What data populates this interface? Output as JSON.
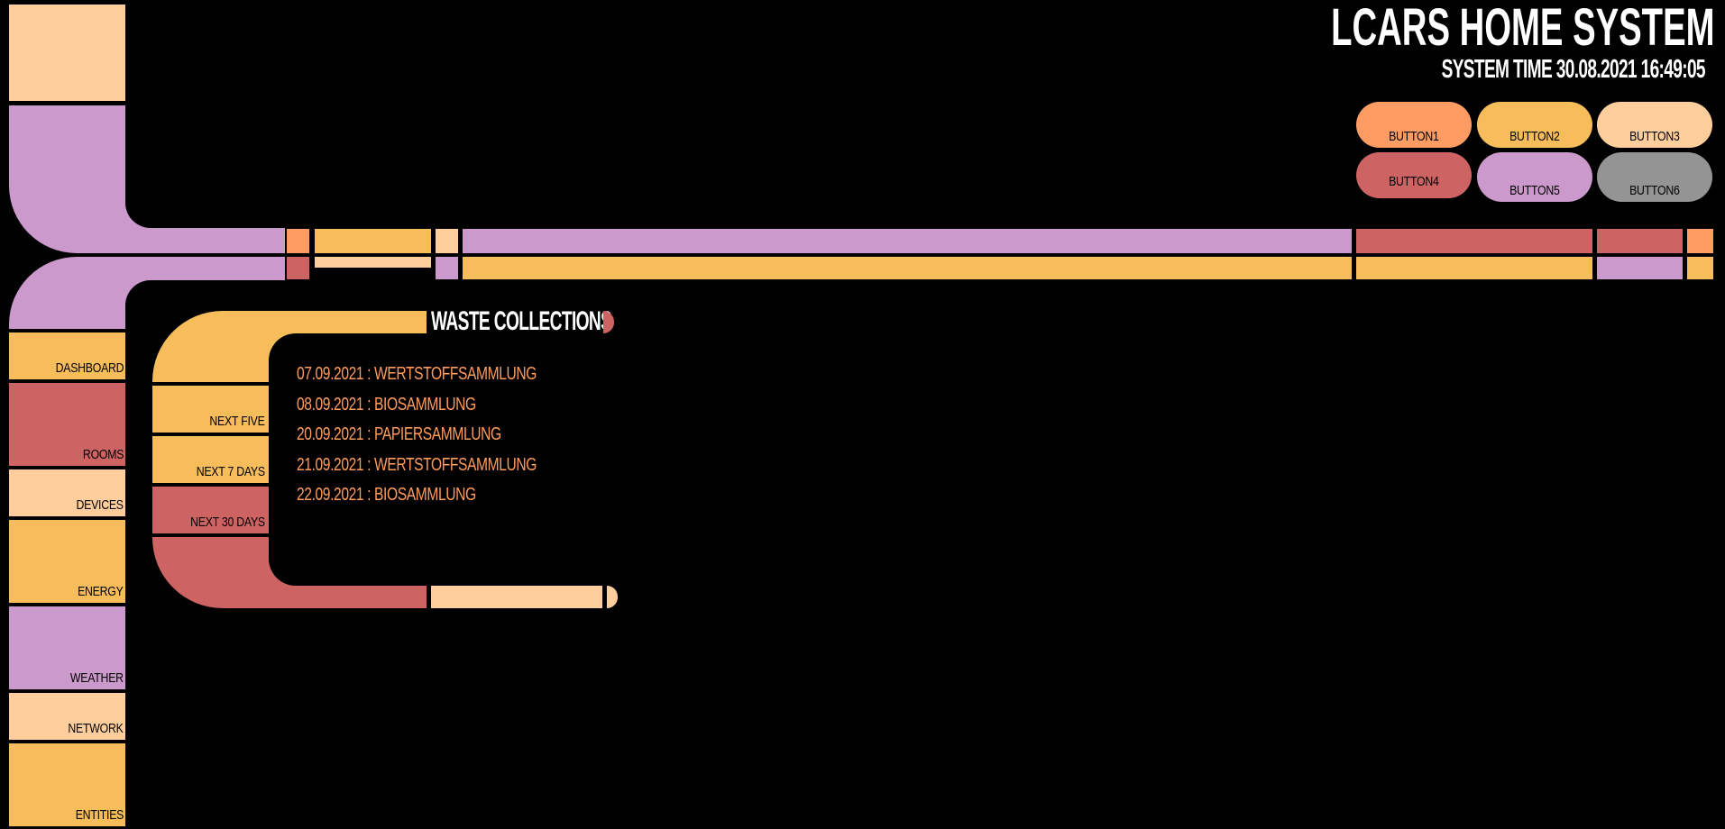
{
  "header": {
    "title": "LCARS HOME SYSTEM",
    "system_time": "SYSTEM TIME 30.08.2021 16:49:05"
  },
  "top_buttons": [
    {
      "label": "BUTTON1",
      "color": "#ff9c63"
    },
    {
      "label": "BUTTON2",
      "color": "#f7bd5a"
    },
    {
      "label": "BUTTON3",
      "color": "#ffce9c"
    },
    {
      "label": "BUTTON4",
      "color": "#ce6363"
    },
    {
      "label": "BUTTON5",
      "color": "#cc99cc"
    },
    {
      "label": "BUTTON6",
      "color": "#949494"
    }
  ],
  "sidebar": {
    "items": [
      {
        "label": "DASHBOARD",
        "color": "#f7bd5a"
      },
      {
        "label": "ROOMS",
        "color": "#ce6363"
      },
      {
        "label": "DEVICES",
        "color": "#ffce9c"
      },
      {
        "label": "ENERGY",
        "color": "#f7bd5a"
      },
      {
        "label": "WEATHER",
        "color": "#cc99cc"
      },
      {
        "label": "NETWORK",
        "color": "#ffce9c"
      },
      {
        "label": "ENTITIES",
        "color": "#f7bd5a"
      }
    ]
  },
  "panel": {
    "title": "WASTE COLLECTIONS",
    "filters": [
      {
        "label": "NEXT FIVE",
        "color": "#f7bd5a"
      },
      {
        "label": "NEXT 7 DAYS",
        "color": "#f7bd5a"
      },
      {
        "label": "NEXT 30 DAYS",
        "color": "#ce6363"
      }
    ],
    "items": [
      "07.09.2021 : WERTSTOFFSAMMLUNG",
      "08.09.2021 : BIOSAMMLUNG",
      "20.09.2021 : PAPIERSAMMLUNG",
      "21.09.2021 : WERTSTOFFSAMMLUNG",
      "22.09.2021 : BIOSAMMLUNG"
    ]
  },
  "colors": {
    "orange": "#ff9c63",
    "gold": "#f7bd5a",
    "peach": "#ffce9c",
    "red": "#ce6363",
    "lilac": "#cc99cc",
    "gray": "#949494",
    "text_orange": "#ff9c5a"
  }
}
